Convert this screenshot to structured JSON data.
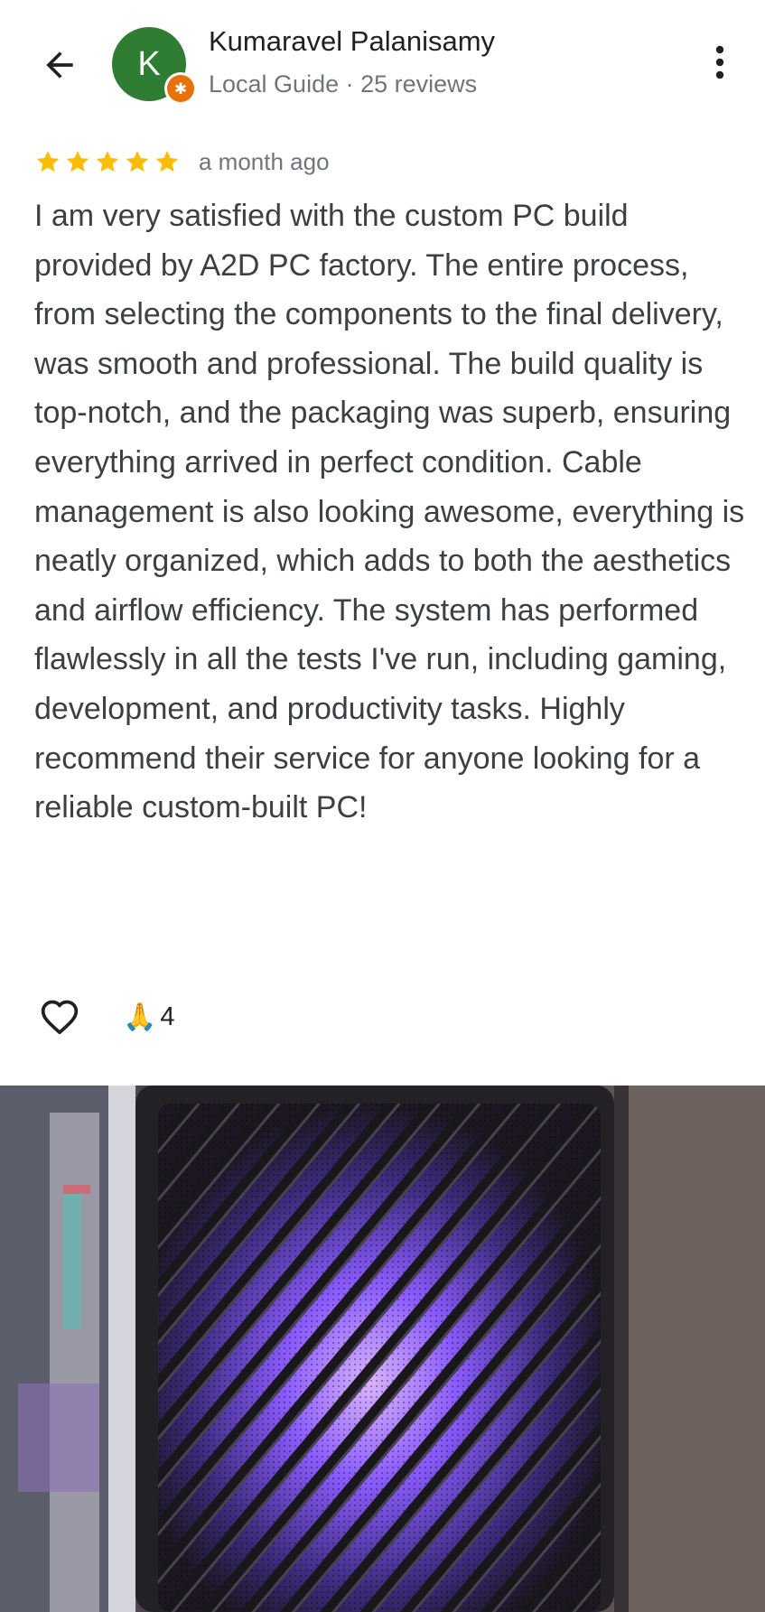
{
  "header": {
    "back_icon": "arrow-back-icon",
    "avatar_letter": "K",
    "avatar_color": "#2e7d32",
    "badge_icon": "local-guide-star-icon",
    "badge_color": "#e8710a",
    "reviewer_name": "Kumaravel Palanisamy",
    "reviewer_meta": "Local Guide · 25 reviews",
    "more_icon": "more-vert-icon"
  },
  "review": {
    "stars": 5,
    "star_color": "#fbbc04",
    "time": "a month ago",
    "text": "I am very satisfied with the custom PC build provided by A2D PC factory. The entire process, from selecting the components to the final delivery, was smooth and professional. The build quality is top-notch, and the packaging was superb, ensuring everything arrived in perfect condition. Cable management is also looking awesome, everything is neatly organized, which adds to both the aesthetics and airflow efficiency. The system has performed flawlessly in all the tests I've run, including gaming, development, and productivity tasks. Highly recommend their service for anyone looking for a reliable custom-built PC!"
  },
  "actions": {
    "like_icon": "heart-outline-icon",
    "reaction_emoji": "🙏",
    "reaction_count": "4"
  },
  "photo": {
    "subject": "pc-case-mesh-panel-purple-lighting",
    "glow_color": "#8a5cff"
  }
}
